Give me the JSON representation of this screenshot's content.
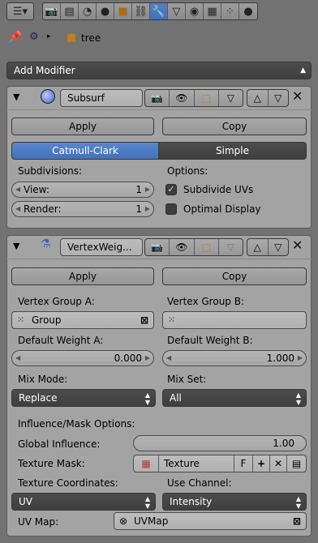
{
  "header": {
    "editor_menu_icon": "editor-type-icon",
    "context_tabs": [
      "render-icon",
      "scene-icon",
      "world-icon",
      "object-icon",
      "constraint-icon",
      "modifier-icon",
      "data-icon",
      "material-icon",
      "texture-icon",
      "particles-icon",
      "physics-icon"
    ],
    "active_tab": "modifier-icon"
  },
  "breadcrumb": {
    "object_name": "tree"
  },
  "add_modifier": {
    "label": "Add Modifier"
  },
  "subsurf": {
    "name": "Subsurf",
    "apply_label": "Apply",
    "copy_label": "Copy",
    "tabs": [
      "Catmull-Clark",
      "Simple"
    ],
    "active_tab": "Catmull-Clark",
    "subdivisions_label": "Subdivisions:",
    "view_label": "View:",
    "view_value": "1",
    "render_label": "Render:",
    "render_value": "1",
    "options_label": "Options:",
    "subdivide_uvs_label": "Subdivide UVs",
    "subdivide_uvs_checked": true,
    "optimal_display_label": "Optimal Display",
    "optimal_display_checked": false
  },
  "vertex_weight": {
    "name": "VertexWeig...",
    "apply_label": "Apply",
    "copy_label": "Copy",
    "group_a_label": "Vertex Group A:",
    "group_a_value": "Group",
    "group_b_label": "Vertex Group B:",
    "group_b_value": "",
    "default_a_label": "Default Weight A:",
    "default_a_value": "0.000",
    "default_b_label": "Default Weight B:",
    "default_b_value": "1.000",
    "mix_mode_label": "Mix Mode:",
    "mix_mode_value": "Replace",
    "mix_set_label": "Mix Set:",
    "mix_set_value": "All",
    "influence_label": "Influence/Mask Options:",
    "global_influence_label": "Global Influence:",
    "global_influence_value": "1.00",
    "texture_mask_label": "Texture Mask:",
    "texture_value": "Texture",
    "texture_f_label": "F",
    "texture_coords_label": "Texture Coordinates:",
    "texture_coords_value": "UV",
    "use_channel_label": "Use Channel:",
    "use_channel_value": "Intensity",
    "uv_map_label": "UV Map:",
    "uv_map_value": "UVMap"
  },
  "colors": {
    "background": "#727272",
    "panel": "#a3a3a3",
    "accent": "#5680c2",
    "dark_tab": "#3f3f3f"
  }
}
